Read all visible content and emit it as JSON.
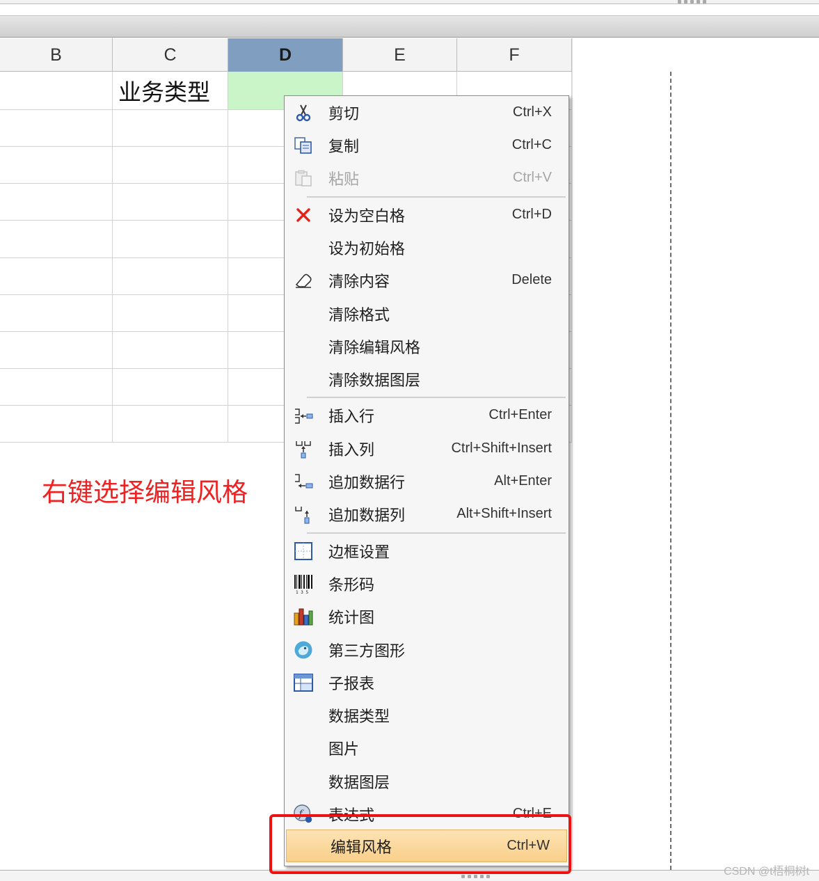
{
  "colors": {
    "accent_red": "#ee1111",
    "selected_header": "#7f9ec0",
    "selected_cell": "#c9f5c9",
    "menu_highlight": "#f9cf8a"
  },
  "columns": [
    "B",
    "C",
    "D",
    "E",
    "F"
  ],
  "selected_column": "D",
  "cells": {
    "c1": "业务类型"
  },
  "menu": {
    "items": [
      {
        "label": "剪切",
        "shortcut": "Ctrl+X",
        "icon": "scissors-icon"
      },
      {
        "label": "复制",
        "shortcut": "Ctrl+C",
        "icon": "copy-icon"
      },
      {
        "label": "粘贴",
        "shortcut": "Ctrl+V",
        "icon": "paste-icon",
        "disabled": true
      },
      {
        "label": "设为空白格",
        "shortcut": "Ctrl+D",
        "icon": "red-x-icon"
      },
      {
        "label": "设为初始格",
        "shortcut": "",
        "icon": ""
      },
      {
        "label": "清除内容",
        "shortcut": "Delete",
        "icon": "eraser-icon"
      },
      {
        "label": "清除格式",
        "shortcut": "",
        "icon": ""
      },
      {
        "label": "清除编辑风格",
        "shortcut": "",
        "icon": ""
      },
      {
        "label": "清除数据图层",
        "shortcut": "",
        "icon": ""
      },
      {
        "label": "插入行",
        "shortcut": "Ctrl+Enter",
        "icon": "insert-row-icon"
      },
      {
        "label": "插入列",
        "shortcut": "Ctrl+Shift+Insert",
        "icon": "insert-column-icon"
      },
      {
        "label": "追加数据行",
        "shortcut": "Alt+Enter",
        "icon": "append-row-icon"
      },
      {
        "label": "追加数据列",
        "shortcut": "Alt+Shift+Insert",
        "icon": "append-column-icon"
      },
      {
        "label": "边框设置",
        "shortcut": "",
        "icon": "border-icon"
      },
      {
        "label": "条形码",
        "shortcut": "",
        "icon": "barcode-icon"
      },
      {
        "label": "统计图",
        "shortcut": "",
        "icon": "bar-chart-icon"
      },
      {
        "label": "第三方图形",
        "shortcut": "",
        "icon": "third-party-graphic-icon"
      },
      {
        "label": "子报表",
        "shortcut": "",
        "icon": "subreport-icon"
      },
      {
        "label": "数据类型",
        "shortcut": "",
        "icon": ""
      },
      {
        "label": "图片",
        "shortcut": "",
        "icon": ""
      },
      {
        "label": "数据图层",
        "shortcut": "",
        "icon": ""
      },
      {
        "label": "表达式",
        "shortcut": "Ctrl+E",
        "icon": "expression-icon"
      },
      {
        "label": "编辑风格",
        "shortcut": "Ctrl+W",
        "icon": "",
        "highlighted": true
      }
    ]
  },
  "annotation": "右键选择编辑风格",
  "watermark": "CSDN @t梧桐树t"
}
